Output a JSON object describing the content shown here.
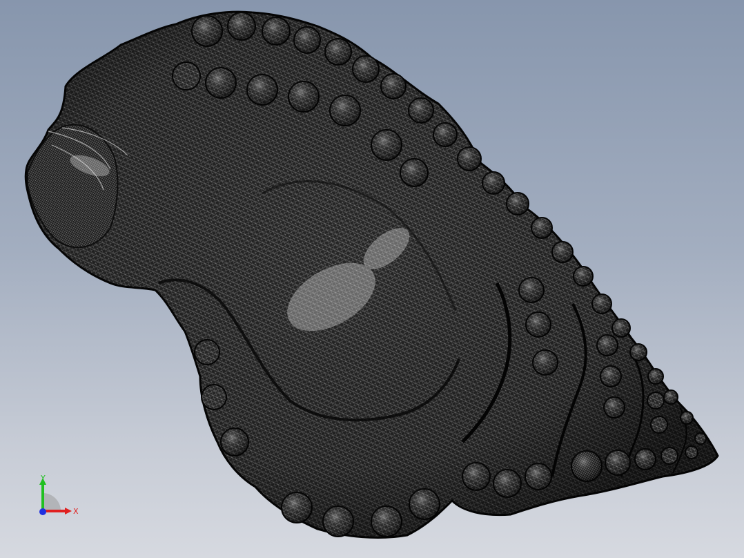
{
  "viewport": {
    "background_top": "#8796ad",
    "background_bottom": "#d6d9e0"
  },
  "model": {
    "icon": "seashell-mesh",
    "mesh_color": "#1a1a1a",
    "highlight_color": "#f2f2f2"
  },
  "triad": {
    "x_label": "X",
    "y_label": "Y",
    "x_color": "#e02020",
    "y_color": "#20c020",
    "z_color": "#2030e0"
  }
}
